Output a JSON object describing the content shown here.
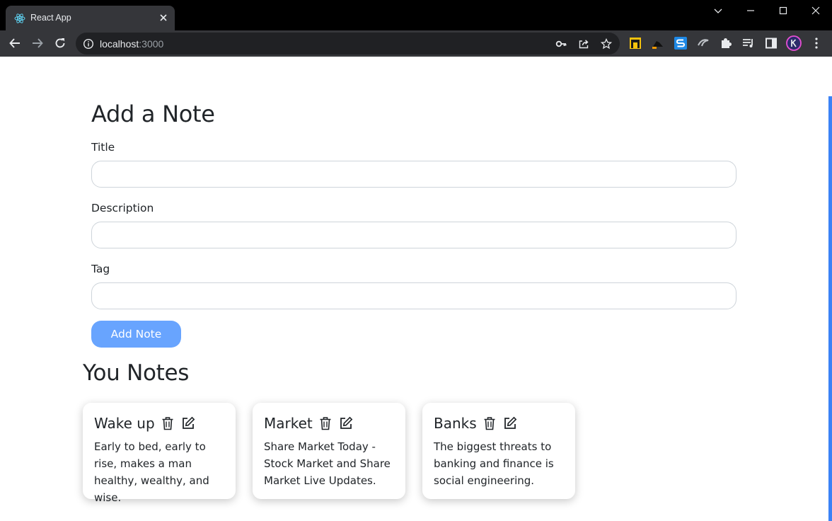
{
  "browser": {
    "tab": {
      "title": "React App"
    },
    "address": {
      "host": "localhost",
      "port": ":3000"
    }
  },
  "form": {
    "heading": "Add a Note",
    "fields": [
      {
        "label": "Title",
        "value": "",
        "placeholder": ""
      },
      {
        "label": "Description",
        "value": "",
        "placeholder": ""
      },
      {
        "label": "Tag",
        "value": "",
        "placeholder": ""
      }
    ],
    "submit_label": "Add Note"
  },
  "notes": {
    "heading": "You Notes",
    "items": [
      {
        "title": "Wake up",
        "description": "Early to bed, early to rise, makes a man healthy, wealthy, and wise."
      },
      {
        "title": "Market",
        "description": "Share Market Today - Stock Market and Share Market Live Updates."
      },
      {
        "title": "Banks",
        "description": "The biggest threats to banking and finance is social engineering."
      }
    ]
  },
  "colors": {
    "accent": "#68a4fe",
    "chrome_dark": "#35363a",
    "text": "#212529"
  },
  "icons": {
    "delete": "trash-icon",
    "edit": "edit-icon"
  }
}
